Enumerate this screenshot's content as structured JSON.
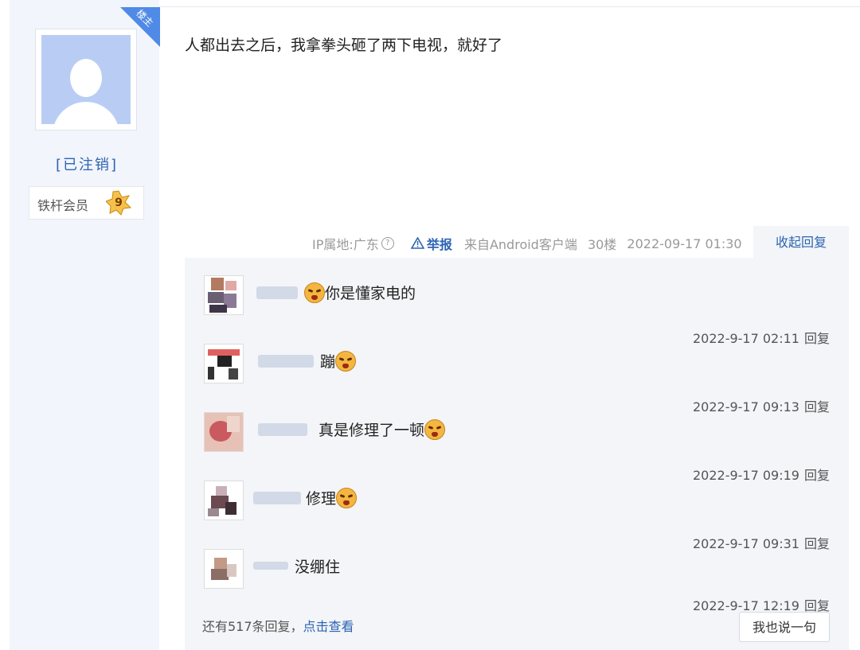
{
  "author": {
    "floor_badge": "楼主",
    "username": "[已注销]",
    "member_label": "铁杆会员",
    "level": "9"
  },
  "post": {
    "content": "人都出去之后，我拿拳头砸了两下电视，就好了"
  },
  "meta": {
    "ip_location": "IP属地:广东",
    "report": "举报",
    "source": "来自Android客户端",
    "floor": "30楼",
    "datetime": "2022-09-17 01:30",
    "collapse": "收起回复"
  },
  "replies": [
    {
      "text": "你是懂家电的",
      "time": "2022-9-17 02:11",
      "reply_label": "回复"
    },
    {
      "text": "蹦",
      "time": "2022-9-17 09:13",
      "reply_label": "回复"
    },
    {
      "text": "真是修理了一顿",
      "time": "2022-9-17 09:19",
      "reply_label": "回复"
    },
    {
      "text": "修理",
      "time": "2022-9-17 09:31",
      "reply_label": "回复"
    },
    {
      "text": "没绷住",
      "time": "2022-9-17 12:19",
      "reply_label": "回复"
    }
  ],
  "footer": {
    "more_prefix": "还有517条回复，",
    "more_link": "点击查看",
    "say_button": "我也说一句"
  },
  "colors": {
    "link_blue": "#2d64b3",
    "badge_blue": "#4f8be6",
    "panel_gray": "#f3f5f8"
  }
}
